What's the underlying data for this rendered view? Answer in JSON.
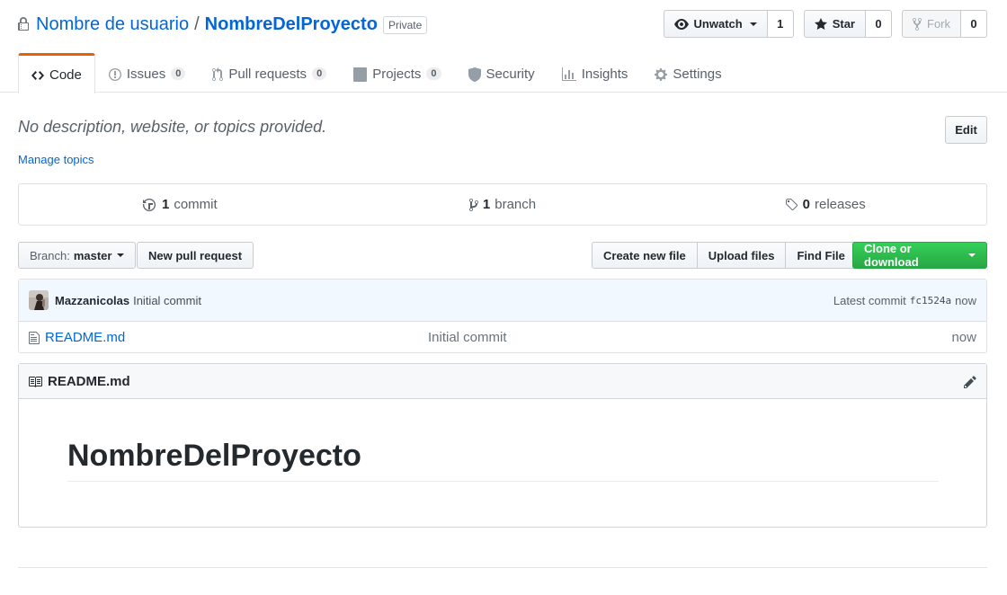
{
  "repo": {
    "owner": "Nombre de usuario",
    "separator": "/",
    "name": "NombreDelProyecto",
    "visibility": "Private"
  },
  "actions": {
    "watch": {
      "label": "Unwatch",
      "count": "1"
    },
    "star": {
      "label": "Star",
      "count": "0"
    },
    "fork": {
      "label": "Fork",
      "count": "0"
    }
  },
  "nav": {
    "code": {
      "label": "Code"
    },
    "issues": {
      "label": "Issues",
      "count": "0"
    },
    "pulls": {
      "label": "Pull requests",
      "count": "0"
    },
    "projects": {
      "label": "Projects",
      "count": "0"
    },
    "security": {
      "label": "Security"
    },
    "insights": {
      "label": "Insights"
    },
    "settings": {
      "label": "Settings"
    }
  },
  "description": {
    "text": "No description, website, or topics provided.",
    "edit_label": "Edit",
    "manage_topics": "Manage topics"
  },
  "summary": {
    "commits": {
      "count": "1",
      "label": "commit"
    },
    "branches": {
      "count": "1",
      "label": "branch"
    },
    "releases": {
      "count": "0",
      "label": "releases"
    }
  },
  "toolbar": {
    "branch_prefix": "Branch:",
    "branch_name": "master",
    "new_pull_request": "New pull request",
    "create_new_file": "Create new file",
    "upload_files": "Upload files",
    "find_file": "Find File",
    "clone_or_download": "Clone or download"
  },
  "commit": {
    "author": "Mazzanicolas",
    "message": "Initial commit",
    "latest_label": "Latest commit",
    "sha": "fc1524a",
    "age": "now"
  },
  "files": [
    {
      "name": "README.md",
      "message": "Initial commit",
      "age": "now"
    }
  ],
  "readme": {
    "filename": "README.md",
    "heading": "NombreDelProyecto"
  },
  "colors": {
    "link": "#0366d6",
    "accent_tab": "#e36209",
    "clone_green": "#28a745",
    "commit_bg": "#f1f8ff"
  }
}
